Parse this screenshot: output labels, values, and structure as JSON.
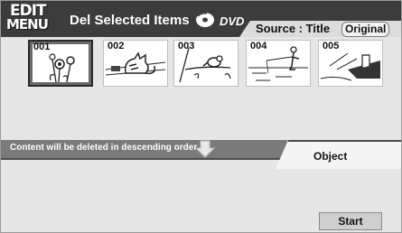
{
  "header": {
    "logo_top": "EDIT",
    "logo_bottom": "MENU",
    "title": "Del Selected Items",
    "disc_label": "DVD",
    "source_label": "Source : Title",
    "original_button": "Original"
  },
  "thumbnails": [
    {
      "number": "001",
      "selected": true,
      "icon": "flowers-picture"
    },
    {
      "number": "002",
      "selected": false,
      "icon": "cat-picture"
    },
    {
      "number": "003",
      "selected": false,
      "icon": "birds-on-branch-picture"
    },
    {
      "number": "004",
      "selected": false,
      "icon": "fishing-picture"
    },
    {
      "number": "005",
      "selected": false,
      "icon": "ship-picture"
    }
  ],
  "info": {
    "message": "Content will be deleted in descending order",
    "object_label": "Object"
  },
  "footer": {
    "start_button": "Start"
  },
  "colors": {
    "header_bg": "#3c3c3c",
    "screen_bg": "#e6e6e6",
    "info_bar_bg": "#7a7a7a"
  }
}
